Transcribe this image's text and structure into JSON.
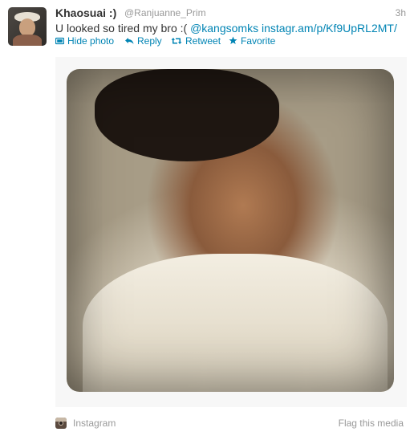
{
  "tweet": {
    "fullname": "Khaosuai :)",
    "screen_name": "@Ranjuanne_Prim",
    "time": "3h",
    "text_plain": "U looked so tired my bro :( ",
    "mention": "@kangsomks",
    "url": "instagr.am/p/Kf9UpRL2MT/"
  },
  "actions": {
    "hide_photo": "Hide photo",
    "reply": "Reply",
    "retweet": "Retweet",
    "favorite": "Favorite"
  },
  "media": {
    "source": "Instagram",
    "flag": "Flag this media"
  },
  "icons": {
    "hide_photo": "photo-icon",
    "reply": "reply-arrow-icon",
    "retweet": "retweet-icon",
    "favorite": "star-icon",
    "source": "instagram-icon"
  },
  "colors": {
    "link": "#0084b4",
    "muted": "#999999",
    "text": "#333333"
  }
}
